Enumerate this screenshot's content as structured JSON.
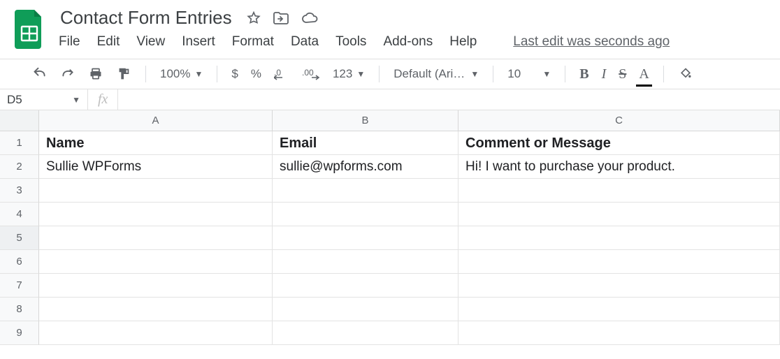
{
  "title": "Contact Form Entries",
  "menus": [
    "File",
    "Edit",
    "View",
    "Insert",
    "Format",
    "Data",
    "Tools",
    "Add-ons",
    "Help"
  ],
  "last_edit": "Last edit was seconds ago",
  "toolbar": {
    "zoom": "100%",
    "font_name": "Default (Ari…",
    "font_size": "10",
    "decrease_dec": ".0",
    "increase_dec": ".00",
    "num_fmt": "123",
    "currency": "$",
    "percent": "%",
    "bold": "B",
    "italic": "I",
    "strike": "S",
    "textcolor": "A"
  },
  "name_box": "D5",
  "fx_label": "fx",
  "columns": [
    "A",
    "B",
    "C"
  ],
  "rows": [
    "1",
    "2",
    "3",
    "4",
    "5",
    "6",
    "7",
    "8",
    "9"
  ],
  "selected_row": "5",
  "data": {
    "headers": [
      "Name",
      "Email",
      "Comment or Message"
    ],
    "r2": [
      "Sullie WPForms",
      "sullie@wpforms.com",
      "Hi! I want to purchase your product."
    ]
  }
}
